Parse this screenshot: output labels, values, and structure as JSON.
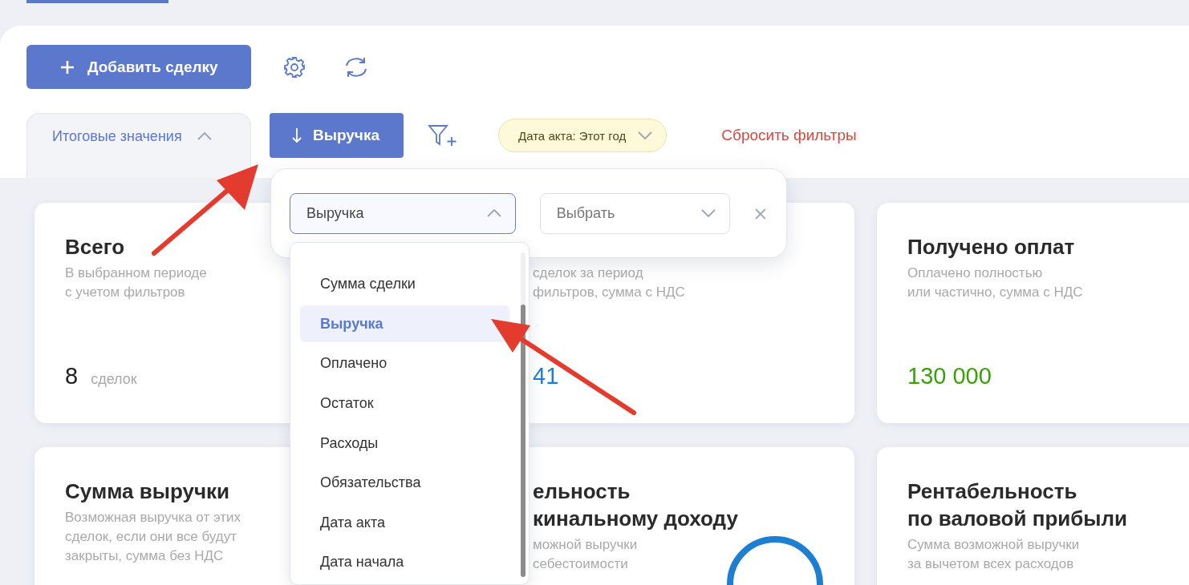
{
  "toolbar": {
    "add_button": {
      "label": "Добавить сделку"
    }
  },
  "filters": {
    "totals_tab": {
      "label": "Итоговые значения",
      "expanded": true
    },
    "sort_button": {
      "label": "Выручка"
    },
    "date_chip": {
      "label": "Дата акта: Этот год",
      "expanded": false
    },
    "reset_link": {
      "label": "Сбросить фильтры"
    }
  },
  "popover": {
    "field_select": {
      "value": "Выручка",
      "expanded": true
    },
    "operator_select": {
      "placeholder": "Выбрать",
      "expanded": false
    },
    "options": [
      {
        "label": "Сумма сделки",
        "selected": false
      },
      {
        "label": "Выручка",
        "selected": true
      },
      {
        "label": "Оплачено",
        "selected": false
      },
      {
        "label": "Остаток",
        "selected": false
      },
      {
        "label": "Расходы",
        "selected": false
      },
      {
        "label": "Обязательства",
        "selected": false
      },
      {
        "label": "Дата акта",
        "selected": false
      },
      {
        "label": "Дата начала",
        "selected": false
      }
    ]
  },
  "cards": [
    {
      "kind": "full",
      "title": [
        "Всего"
      ],
      "description": [
        "В выбранном периоде",
        "с учетом фильтров"
      ],
      "value": "8",
      "unit": "сделок",
      "color": "#222222"
    },
    {
      "kind": "partial",
      "description": [
        "сделок за период",
        "фильтров, сумма с НДС"
      ],
      "value": "41",
      "color": "#1e7fd0"
    },
    {
      "kind": "full",
      "title": [
        "Получено оплат"
      ],
      "description": [
        "Оплачено полностью",
        "или частично, сумма с НДС"
      ],
      "value": "130 000",
      "color": "#3aa10a"
    },
    {
      "kind": "full",
      "title": [
        "Сумма выручки"
      ],
      "description": [
        "Возможная выручка от этих",
        "сделок, если они все будут",
        "закрыты, сумма без НДС"
      ]
    },
    {
      "kind": "partial",
      "title": [
        "ельность",
        "кинальному доходу"
      ],
      "description": [
        "можной выручки",
        "себестоимости"
      ],
      "gauge": true
    },
    {
      "kind": "full",
      "title": [
        "Рентабельность",
        "по валовой прибыли"
      ],
      "description": [
        "Сумма возможной выручки",
        "за вычетом всех расходов"
      ]
    }
  ]
}
